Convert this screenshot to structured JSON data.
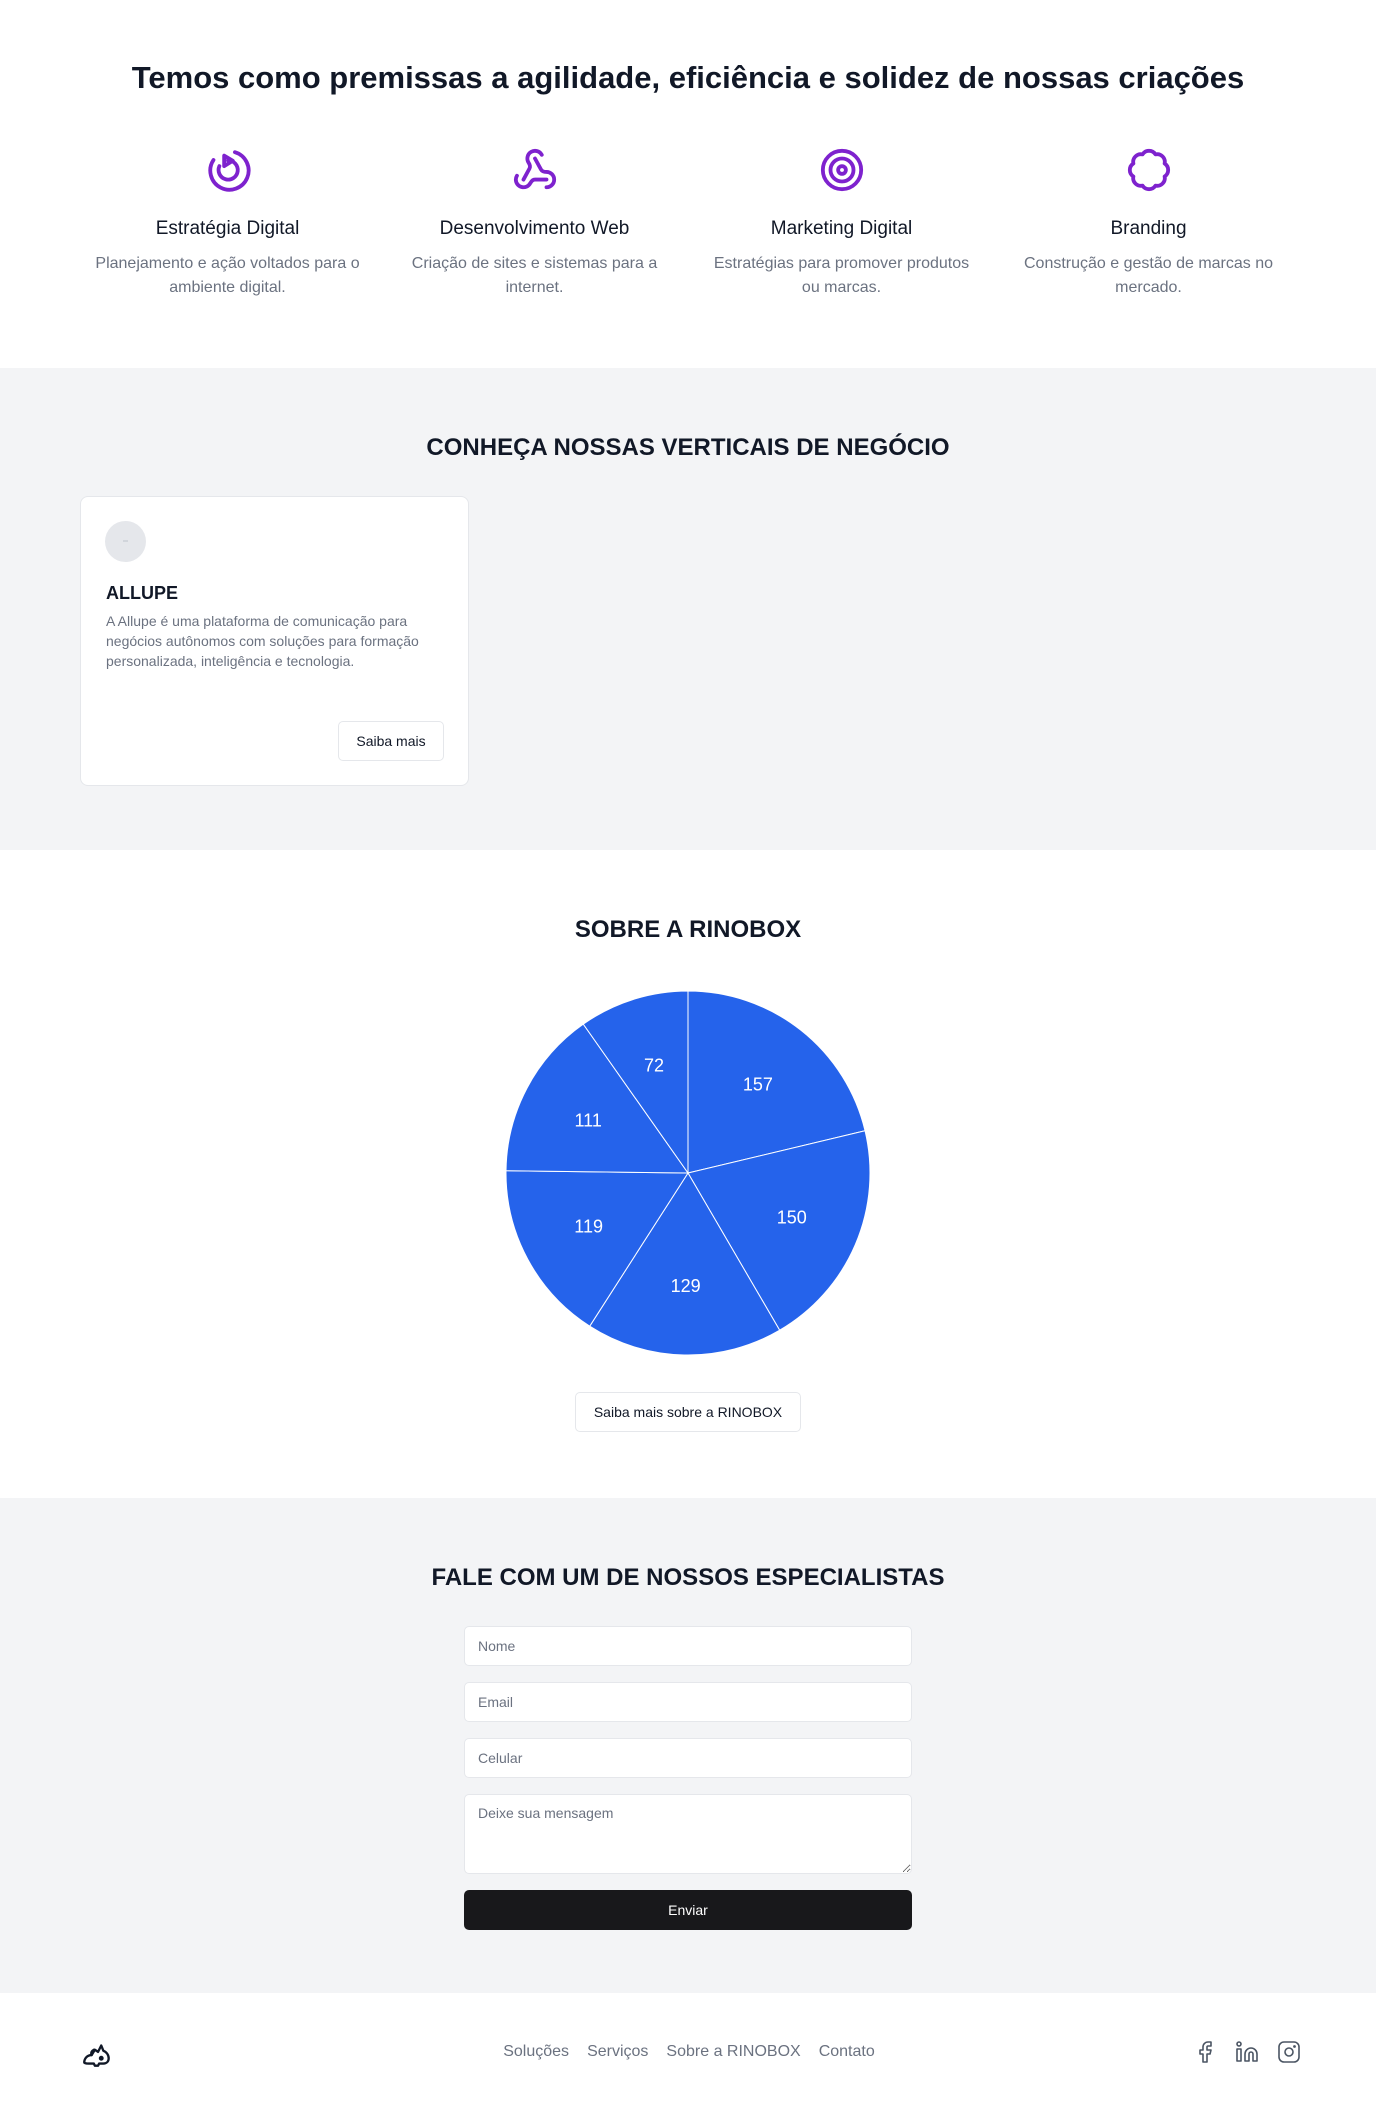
{
  "hero": {
    "title": "Temos como premissas a agilidade, eficiência e solidez de nossas criações",
    "accent_color": "#7e22ce",
    "features": [
      {
        "icon": "target-play-icon",
        "title": "Estratégia Digital",
        "desc": "Planejamento e ação voltados para o ambiente digital."
      },
      {
        "icon": "webhook-icon",
        "title": "Desenvolvimento Web",
        "desc": "Criação de sites e sistemas para a internet."
      },
      {
        "icon": "target-icon",
        "title": "Marketing Digital",
        "desc": "Estratégias para promover produtos ou marcas."
      },
      {
        "icon": "badge-icon",
        "title": "Branding",
        "desc": "Construção e gestão de marcas no mercado."
      }
    ]
  },
  "verticals": {
    "title": "CONHEÇA NOSSAS VERTICAIS DE NEGÓCIO",
    "card": {
      "name": "ALLUPE",
      "desc": "A Allupe é uma plataforma de comunicação para negócios autônomos com soluções para formação personalizada, inteligência e tecnologia.",
      "button": "Saiba mais"
    }
  },
  "about": {
    "title": "SOBRE A RINOBOX",
    "button": "Saiba mais sobre a RINOBOX"
  },
  "chart_data": {
    "type": "pie",
    "values": [
      157,
      150,
      129,
      119,
      111,
      72
    ],
    "colors": [
      "#2563eb"
    ]
  },
  "contact": {
    "title": "FALE COM UM DE NOSSOS ESPECIALISTAS",
    "name_placeholder": "Nome",
    "email_placeholder": "Email",
    "phone_placeholder": "Celular",
    "message_placeholder": "Deixe sua mensagem",
    "submit": "Enviar"
  },
  "footer": {
    "logo": "rhino-logo-icon",
    "nav": [
      "Soluções",
      "Serviços",
      "Sobre a RINOBOX",
      "Contato"
    ],
    "social": [
      "facebook-icon",
      "linkedin-icon",
      "instagram-icon"
    ]
  }
}
